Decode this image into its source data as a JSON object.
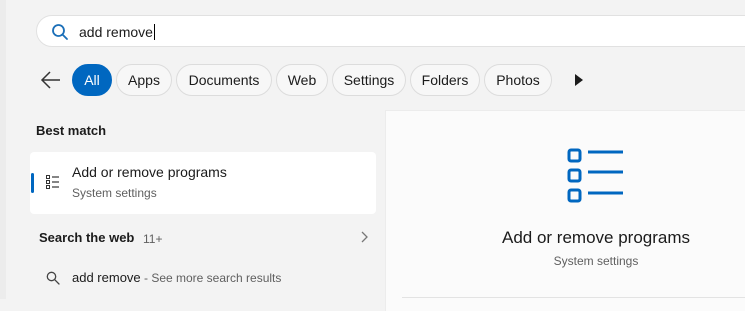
{
  "search": {
    "query": "add remove",
    "icon": "search-icon"
  },
  "filters": {
    "back_icon": "arrow-left-icon",
    "chips": [
      "All",
      "Apps",
      "Documents",
      "Web",
      "Settings",
      "Folders",
      "Photos"
    ],
    "active": "All",
    "more_icon": "play-right-icon"
  },
  "best_match": {
    "header": "Best match",
    "title": "Add or remove programs",
    "subtitle": "System settings",
    "icon": "list-settings-icon"
  },
  "search_web": {
    "header": "Search the web",
    "count": "11+",
    "result_query": "add remove",
    "result_hint": " - See more search results"
  },
  "preview": {
    "title": "Add or remove programs",
    "subtitle": "System settings",
    "icon": "list-settings-icon"
  },
  "colors": {
    "accent": "#0067c0",
    "background": "#f3f3f3",
    "card": "#ffffff"
  }
}
